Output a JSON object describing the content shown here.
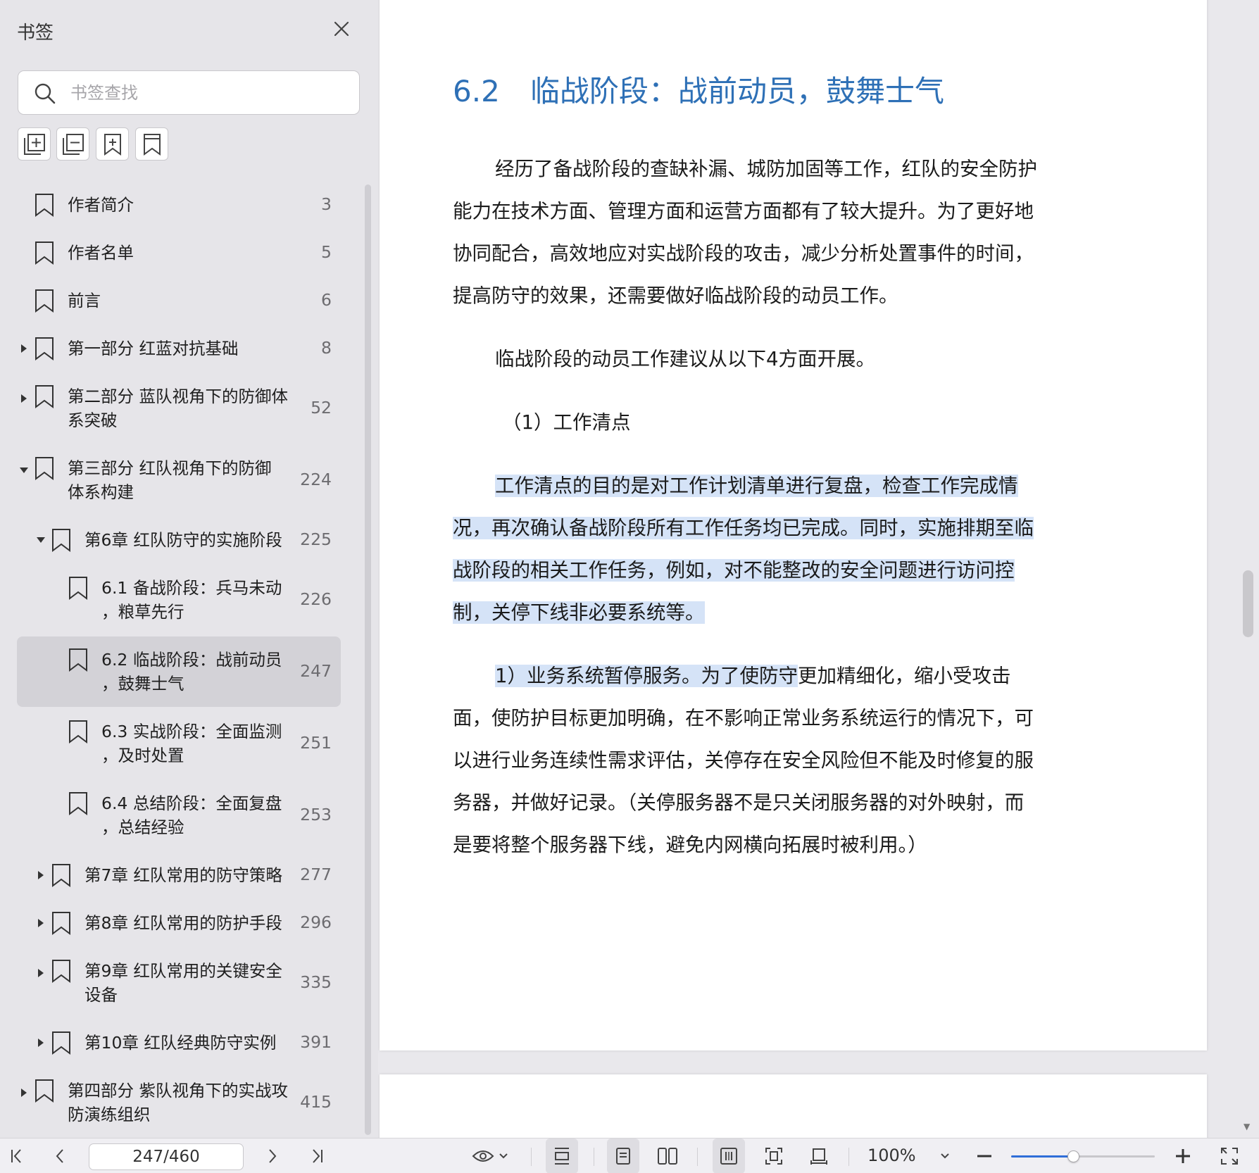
{
  "sidebar": {
    "title": "书签",
    "search_placeholder": "书签查找",
    "toolbar_icons": [
      "expand-all-icon",
      "collapse-all-icon",
      "add-bookmark-icon",
      "bookmark-icon"
    ],
    "items": [
      {
        "label": [
          "作者简介"
        ],
        "page": "3",
        "level": 0,
        "caret": "none"
      },
      {
        "label": [
          "作者名单"
        ],
        "page": "5",
        "level": 0,
        "caret": "none"
      },
      {
        "label": [
          "前言"
        ],
        "page": "6",
        "level": 0,
        "caret": "none"
      },
      {
        "label": [
          "第一部分 红蓝对抗基础"
        ],
        "page": "8",
        "level": 0,
        "caret": "collapsed"
      },
      {
        "label": [
          "第二部分 蓝队视角下的防御体",
          "系突破"
        ],
        "page": "52",
        "level": 0,
        "caret": "collapsed"
      },
      {
        "label": [
          "第三部分 红队视角下的防御",
          "体系构建"
        ],
        "page": "224",
        "level": 0,
        "caret": "expanded"
      },
      {
        "label": [
          "第6章 红队防守的实施阶段"
        ],
        "page": "225",
        "level": 1,
        "caret": "expanded"
      },
      {
        "label": [
          "6.1 备战阶段：兵马未动",
          "，粮草先行"
        ],
        "page": "226",
        "level": 2,
        "caret": "none"
      },
      {
        "label": [
          "6.2 临战阶段：战前动员",
          "，鼓舞士气"
        ],
        "page": "247",
        "level": 2,
        "caret": "none",
        "selected": true
      },
      {
        "label": [
          "6.3 实战阶段：全面监测",
          "，及时处置"
        ],
        "page": "251",
        "level": 2,
        "caret": "none"
      },
      {
        "label": [
          "6.4 总结阶段：全面复盘",
          "，总结经验"
        ],
        "page": "253",
        "level": 2,
        "caret": "none"
      },
      {
        "label": [
          "第7章 红队常用的防守策略"
        ],
        "page": "277",
        "level": 1,
        "caret": "collapsed"
      },
      {
        "label": [
          "第8章 红队常用的防护手段"
        ],
        "page": "296",
        "level": 1,
        "caret": "collapsed"
      },
      {
        "label": [
          "第9章 红队常用的关键安全",
          "设备"
        ],
        "page": "335",
        "level": 1,
        "caret": "collapsed"
      },
      {
        "label": [
          "第10章 红队经典防守实例"
        ],
        "page": "391",
        "level": 1,
        "caret": "collapsed"
      },
      {
        "label": [
          "第四部分 紫队视角下的实战攻",
          "防演练组织"
        ],
        "page": "415",
        "level": 0,
        "caret": "collapsed"
      }
    ]
  },
  "document": {
    "heading_num": "6.2",
    "heading_text": "临战阶段：战前动员，鼓舞士气",
    "p1": [
      "经历了备战阶段的查缺补漏、城防加固等工作，红队的安全防护",
      "能力在技术方面、管理方面和运营方面都有了较大提升。为了更好地",
      "协同配合，高效地应对实战阶段的攻击，减少分析处置事件的时间，",
      "提高防守的效果，还需要做好临战阶段的动员工作。"
    ],
    "p2": "临战阶段的动员工作建议从以下4方面开展。",
    "p3": "（1）工作清点",
    "p4": [
      "工作清点的目的是对工作计划清单进行复盘，检查工作完成情",
      "况，再次确认备战阶段所有工作任务均已完成。同时，实施排期至临",
      "战阶段的相关工作任务，例如，对不能整改的安全问题进行访问控",
      "制，关停下线非必要系统等。"
    ],
    "p5_first_highlight": "1）业务系统暂停服务。为了使防守",
    "p5_first_rest": "更加精细化，缩小受攻击",
    "p5": [
      "面，使防护目标更加明确，在不影响正常业务系统运行的情况下，可",
      "以进行业务连续性需求评估，关停存在安全风险但不能及时修复的服",
      "务器，并做好记录。（关停服务器不是只关闭服务器的对外映射，而",
      "是要将整个服务器下线，避免内网横向拓展时被利用。）"
    ]
  },
  "bottombar": {
    "page_indicator": "247/460",
    "zoom": "100%",
    "zoom_fraction": 0.43,
    "icons": [
      "first-page-icon",
      "prev-page-icon",
      "next-page-icon",
      "last-page-icon",
      "eye-icon",
      "fit-page-icon",
      "single-page-icon",
      "two-page-icon",
      "reading-mode-icon",
      "fit-screen-icon",
      "rotate-icon",
      "zoom-out-icon",
      "zoom-in-icon",
      "fullscreen-icon"
    ]
  },
  "colors": {
    "heading": "#2e70b6",
    "highlight": "#d5e3f7",
    "zoom_accent": "#2f6ed8",
    "sidebar_bg": "#e6e5e9",
    "selected_bg": "#d3d2d7"
  }
}
